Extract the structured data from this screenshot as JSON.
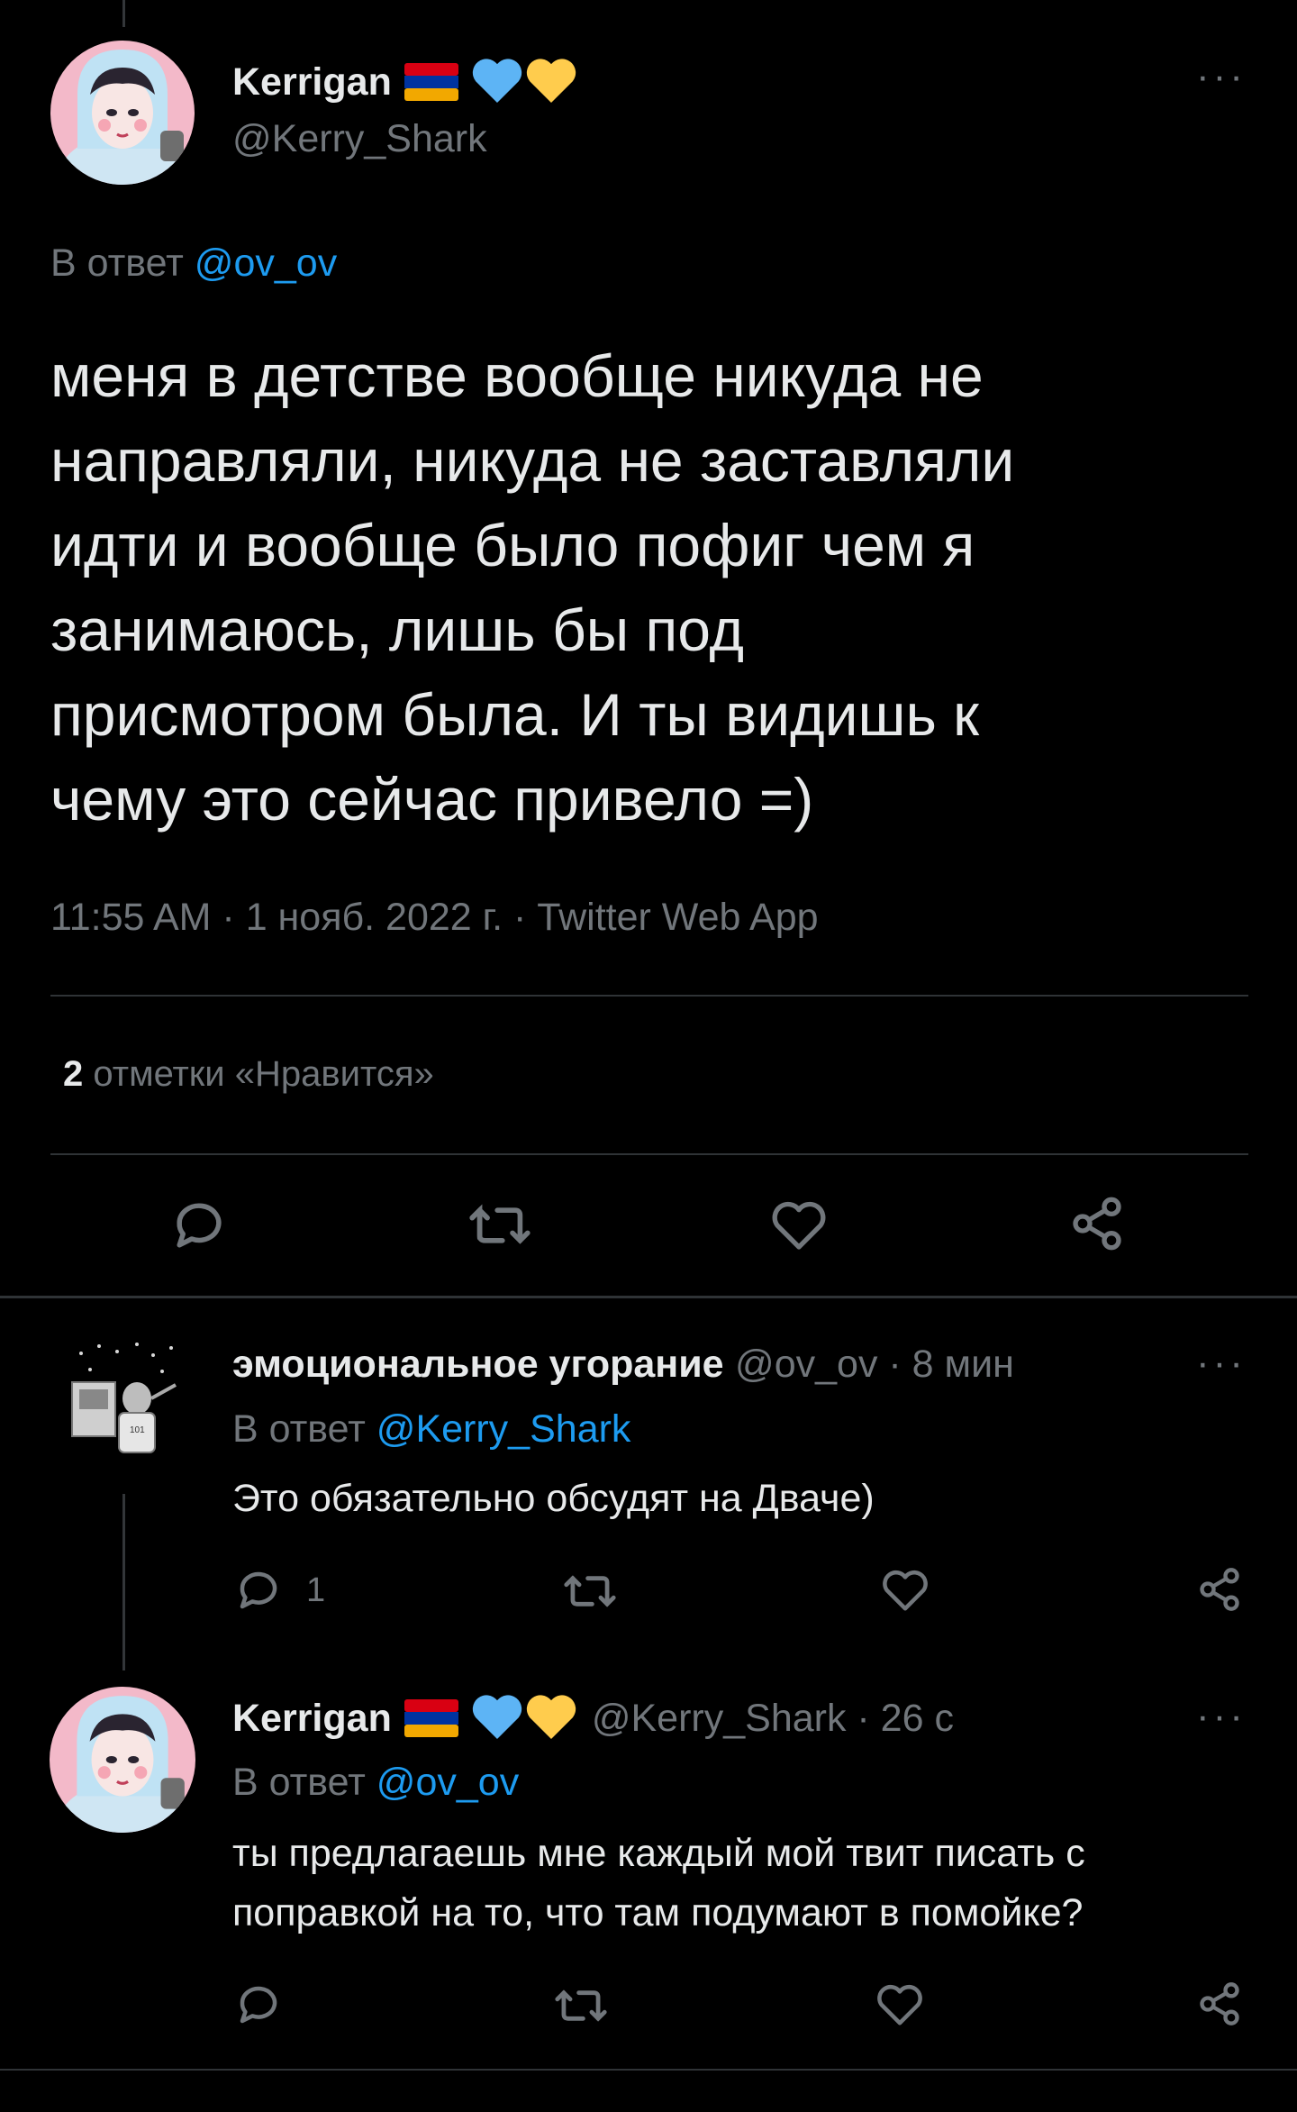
{
  "main_tweet": {
    "display_name": "Kerrigan",
    "handle": "@Kerry_Shark",
    "reply_prefix": "В ответ",
    "reply_to": "@ov_ov",
    "text": "меня в детстве вообще никуда не\nнаправляли, никуда не заставляли\nидти и вообще было пофиг чем я\nзанимаюсь, лишь бы под\nприсмотром была. И ты видишь к\nчему это сейчас привело =)",
    "timestamp": "11:55 AM · 1 нояб. 2022 г. · Twitter Web App",
    "likes_count": "2",
    "likes_label": "отметки «Нравится»",
    "more_icon": "···"
  },
  "replies": [
    {
      "display_name": "эмоциональное угорание",
      "handle_time": "@ov_ov · 8 мин",
      "reply_prefix": "В ответ",
      "reply_to": "@Kerry_Shark",
      "text": "Это обязательно обсудят на Дваче)",
      "reply_count": "1",
      "more_icon": "···"
    },
    {
      "display_name": "Kerrigan",
      "handle_time": "@Kerry_Shark · 26 с",
      "reply_prefix": "В ответ",
      "reply_to": "@ov_ov",
      "text": "ты предлагаешь мне каждый мой твит писать с\nпоправкой на то, что там подумают в помойке?",
      "more_icon": "···"
    }
  ],
  "colors": {
    "background": "#000000",
    "text": "#e7e9ea",
    "secondary": "#71767b",
    "accent": "#1d9bf0",
    "divider": "#2f3336"
  },
  "icons": [
    "reply-icon",
    "retweet-icon",
    "like-icon",
    "share-icon",
    "more-icon"
  ]
}
